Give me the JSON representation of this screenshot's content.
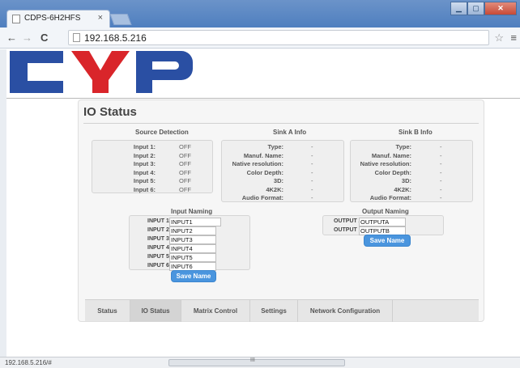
{
  "browser": {
    "tab_title": "CDPS-6H2HFS",
    "tab_close": "×",
    "url": "192.168.5.216",
    "back": "←",
    "forward": "→",
    "reload": "C",
    "star": "☆",
    "menu": "≡",
    "status_url": "192.168.5.216/#",
    "scroll_grip": "III"
  },
  "logo": {
    "alt_text": "CYP"
  },
  "panel": {
    "title": "IO Status",
    "source_detection": {
      "title": "Source Detection",
      "rows": [
        {
          "label": "Input 1:",
          "value": "OFF"
        },
        {
          "label": "Input 2:",
          "value": "OFF"
        },
        {
          "label": "Input 3:",
          "value": "OFF"
        },
        {
          "label": "Input 4:",
          "value": "OFF"
        },
        {
          "label": "Input 5:",
          "value": "OFF"
        },
        {
          "label": "Input 6:",
          "value": "OFF"
        }
      ]
    },
    "sink_a": {
      "title": "Sink A Info",
      "rows": [
        {
          "label": "Type:",
          "value": "-"
        },
        {
          "label": "Manuf. Name:",
          "value": "-"
        },
        {
          "label": "Native resolution:",
          "value": "-"
        },
        {
          "label": "Color Depth:",
          "value": "-"
        },
        {
          "label": "3D:",
          "value": "-"
        },
        {
          "label": "4K2K:",
          "value": "-"
        },
        {
          "label": "Audio Format:",
          "value": "-"
        }
      ]
    },
    "sink_b": {
      "title": "Sink B Info",
      "rows": [
        {
          "label": "Type:",
          "value": "-"
        },
        {
          "label": "Manuf. Name:",
          "value": "-"
        },
        {
          "label": "Native resolution:",
          "value": "-"
        },
        {
          "label": "Color Depth:",
          "value": "-"
        },
        {
          "label": "3D:",
          "value": "-"
        },
        {
          "label": "4K2K:",
          "value": "-"
        },
        {
          "label": "Audio Format:",
          "value": "-"
        }
      ]
    },
    "input_naming": {
      "title": "Input Naming",
      "rows": [
        {
          "label": "INPUT 1",
          "value": "INPUT1"
        },
        {
          "label": "INPUT 2",
          "value": "INPUT2"
        },
        {
          "label": "INPUT 3",
          "value": "INPUT3"
        },
        {
          "label": "INPUT 4",
          "value": "INPUT4"
        },
        {
          "label": "INPUT 5",
          "value": "INPUT5"
        },
        {
          "label": "INPUT 6",
          "value": "INPUT6"
        }
      ],
      "save_label": "Save Name"
    },
    "output_naming": {
      "title": "Output Naming",
      "rows": [
        {
          "label": "OUTPUT A",
          "value": "OUTPUTA"
        },
        {
          "label": "OUTPUT B",
          "value": "OUTPUTB"
        }
      ],
      "save_label": "Save Name"
    },
    "tabs": [
      {
        "label": "Status",
        "active": false
      },
      {
        "label": "IO Status",
        "active": true
      },
      {
        "label": "Matrix Control",
        "active": false
      },
      {
        "label": "Settings",
        "active": false
      },
      {
        "label": "Network Configuration",
        "active": false
      }
    ]
  },
  "colors": {
    "logo_blue": "#2a4fa3",
    "logo_red": "#d9252a",
    "button_blue": "#4a95de"
  }
}
